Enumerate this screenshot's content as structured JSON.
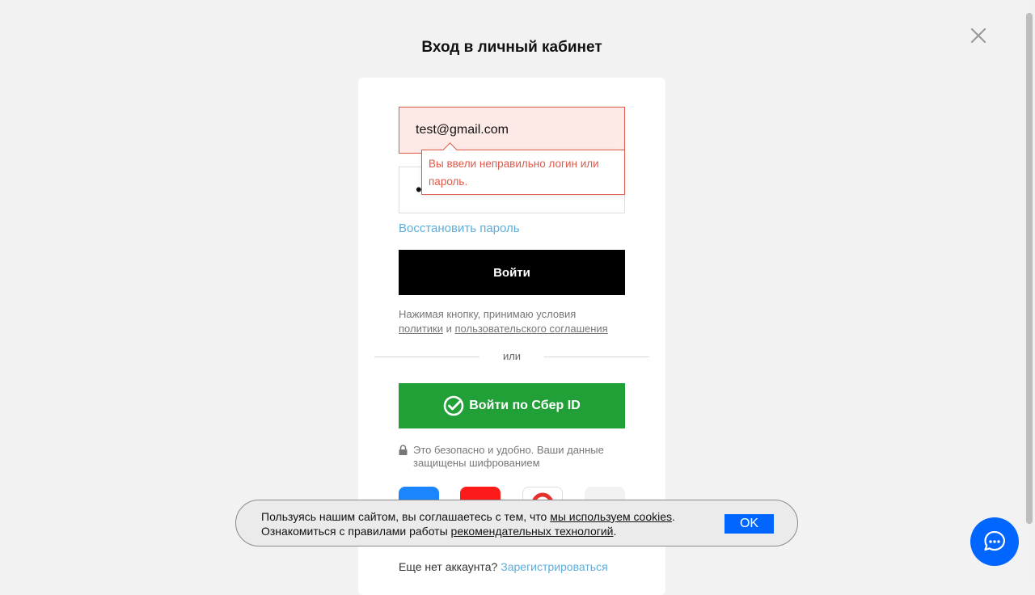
{
  "header": {
    "title": "Вход в личный кабинет"
  },
  "login_form": {
    "email_value": "test@gmail.com",
    "password_value": "••••••••",
    "error_message": "Вы ввели неправильно логин или пароль.",
    "restore_link": "Восстановить пароль",
    "submit_label": "Войти",
    "terms_prefix": "Нажимая кнопку, принимаю условия",
    "terms_policy": "политики",
    "terms_and": "и",
    "terms_agreement": "пользовательского соглашения",
    "divider_text": "или",
    "sber_label": "Войти по Сбер ID",
    "secure_note": "Это безопасно и удобно. Ваши данные защищены шифрованием",
    "social_icons": [
      "vk-icon",
      "yandex-icon",
      "mail-ru-icon",
      "other-icon"
    ],
    "signup_prompt": "Еще нет аккаунта?",
    "signup_link": "Зарегистрироваться"
  },
  "cookie_banner": {
    "text_1": "Пользуясь нашим сайтом, вы соглашаетесь с тем, что",
    "link_1": "мы используем cookies",
    "text_2": "Ознакомиться с правилами работы",
    "link_2": "рекомендательных технологий",
    "ok_label": "OK"
  },
  "colors": {
    "sber_green": "#21a038",
    "error_red": "#e0594a",
    "link_blue": "#5eaedc",
    "primary_blue": "#0066ff"
  }
}
